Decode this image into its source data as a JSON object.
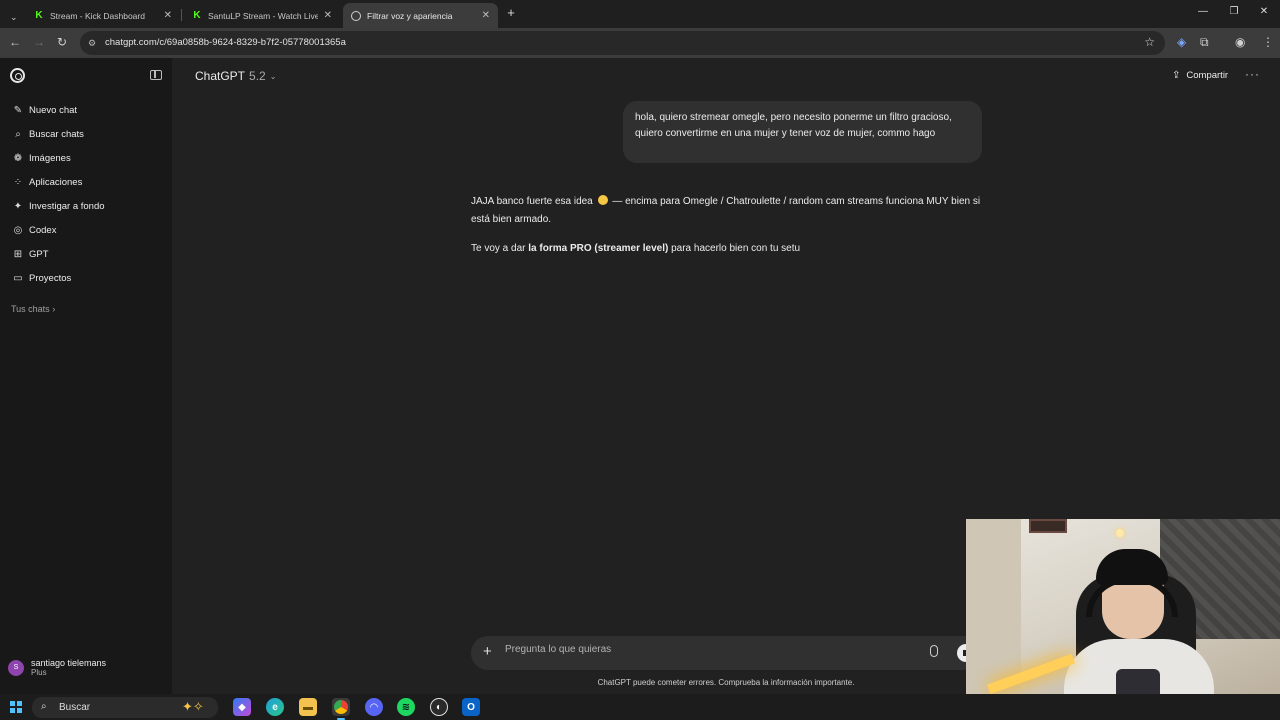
{
  "browser": {
    "tabs": [
      {
        "title": "Stream - Kick Dashboard",
        "active": false,
        "icon": "kick-icon"
      },
      {
        "title": "SantuLP Stream - Watch Live o",
        "active": false,
        "icon": "kick-icon"
      },
      {
        "title": "Filtrar voz y apariencia",
        "active": true,
        "icon": "chatgpt-icon"
      }
    ],
    "url": "chatgpt.com/c/69a0858b-9624-8329-b7f2-05778001365a"
  },
  "sidebar": {
    "items": [
      {
        "label": "Nuevo chat",
        "icon": "new-chat-icon"
      },
      {
        "label": "Buscar chats",
        "icon": "search-icon"
      },
      {
        "label": "Imágenes",
        "icon": "images-icon"
      },
      {
        "label": "Aplicaciones",
        "icon": "apps-icon"
      },
      {
        "label": "Investigar a fondo",
        "icon": "deep-research-icon"
      },
      {
        "label": "Codex",
        "icon": "codex-icon"
      },
      {
        "label": "GPT",
        "icon": "gpt-icon"
      },
      {
        "label": "Proyectos",
        "icon": "projects-icon"
      }
    ],
    "your_chats": "Tus chats",
    "user": {
      "initial": "S",
      "name": "santiago tielemans",
      "plan": "Plus"
    }
  },
  "header": {
    "model_name": "ChatGPT",
    "model_version": "5.2",
    "share_label": "Compartir"
  },
  "conversation": {
    "user_message": "hola, quiero stremear omegle, pero necesito ponerme un filtro gracioso, quiero convertirme en una mujer y tener voz de mujer, commo hago",
    "assistant": {
      "p1_before_emoji": "JAJA banco fuerte esa idea",
      "p1_after_emoji": "— encima para Omegle / Chatroulette / random cam streams funciona MUY bien si está bien armado.",
      "p2_before_bold": "Te voy a dar ",
      "p2_bold": "la forma PRO (streamer level)",
      "p2_after_bold": " para hacerlo bien con tu setu"
    }
  },
  "composer": {
    "placeholder": "Pregunta lo que quieras",
    "disclaimer": "ChatGPT puede cometer errores. Comprueba la información importante."
  },
  "taskbar": {
    "search_label": "Buscar"
  },
  "colors": {
    "background": "#212121",
    "sidebar": "#181818",
    "bubble": "#303030",
    "accent": "#4cc2ff"
  }
}
